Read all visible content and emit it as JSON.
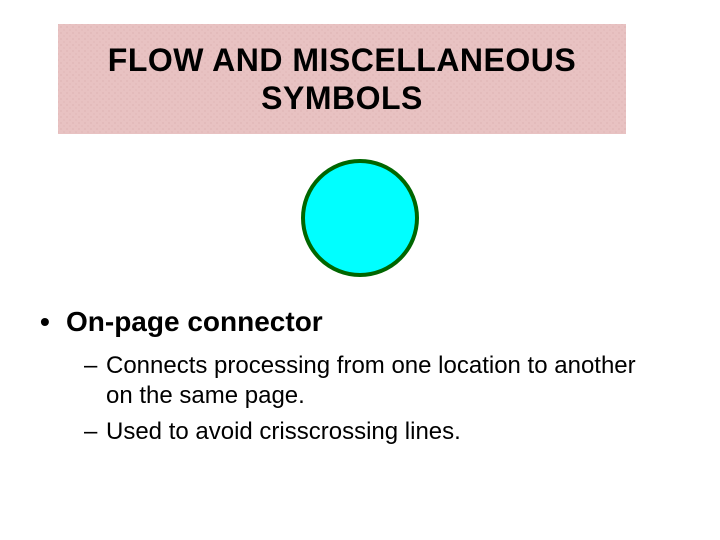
{
  "title": "FLOW AND MISCELLANEOUS\nSYMBOLS",
  "symbol": {
    "name": "on-page-connector",
    "fill": "#00ffff",
    "stroke": "#006600"
  },
  "bullets": {
    "l1_marker": "•",
    "l1_text": "On-page connector",
    "l2_marker": "–",
    "sub1": "Connects processing from one location to another on the same page.",
    "sub2": "Used to avoid crisscrossing lines."
  }
}
